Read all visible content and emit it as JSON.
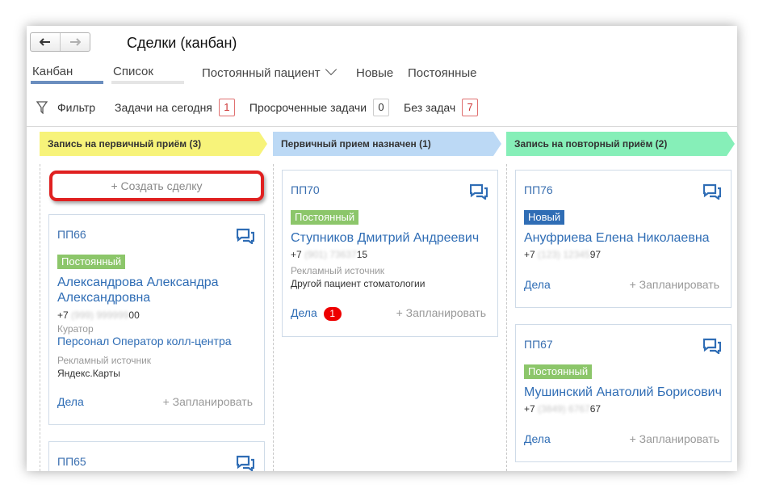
{
  "window": {
    "title": "Сделки (канбан)",
    "nav": {
      "back_icon": "arrow-left-icon",
      "forward_icon": "arrow-right-icon"
    }
  },
  "view_tabs": {
    "kanban": "Канбан",
    "list": "Список"
  },
  "segments": {
    "dropdown": "Постоянный пациент",
    "new": "Новые",
    "regular": "Постоянные"
  },
  "filters": {
    "filter_label": "Фильтр",
    "today_label": "Задачи на сегодня",
    "today_count": "1",
    "overdue_label": "Просроченные задачи",
    "overdue_count": "0",
    "no_tasks_label": "Без задач",
    "no_tasks_count": "7"
  },
  "columns": [
    {
      "title": "Запись на первичный приём (3)",
      "color": "#f7f37a"
    },
    {
      "title": "Первичный прием назначен (1)",
      "color": "#bcd9f5"
    },
    {
      "title": "Запись на повторный приём (2)",
      "color": "#86efb8"
    }
  ],
  "create_deal": "+ Создать сделку",
  "labels": {
    "curator": "Куратор",
    "ad_source": "Рекламный источник",
    "deals": "Дела",
    "plan": "+ Запланировать"
  },
  "cards": {
    "pp66": {
      "id": "ПП66",
      "tag": "Постоянный",
      "name": "Александрова Александра Александровна",
      "phone_prefix": "+7",
      "phone_hidden": "(999) 999999",
      "phone_suffix": "00",
      "curator": "Персонал Оператор колл-центра",
      "ad_source": "Яндекс.Карты"
    },
    "pp65": {
      "id": "ПП65"
    },
    "pp70": {
      "id": "ПП70",
      "tag": "Постоянный",
      "name": "Ступников Дмитрий Андреевич",
      "phone_prefix": "+7",
      "phone_hidden": "(901) 73637",
      "phone_suffix": "15",
      "ad_source": "Другой пациент стоматологии",
      "deals_badge": "1"
    },
    "pp76": {
      "id": "ПП76",
      "tag": "Новый",
      "name": "Ануфриева Елена Николаевна",
      "phone_prefix": "+7",
      "phone_hidden": "(123) 12345",
      "phone_suffix": "97"
    },
    "pp67": {
      "id": "ПП67",
      "tag": "Постоянный",
      "name": "Мушинский Анатолий Борисович",
      "phone_prefix": "+7",
      "phone_hidden": "(3849) 6767",
      "phone_suffix": "67"
    }
  }
}
